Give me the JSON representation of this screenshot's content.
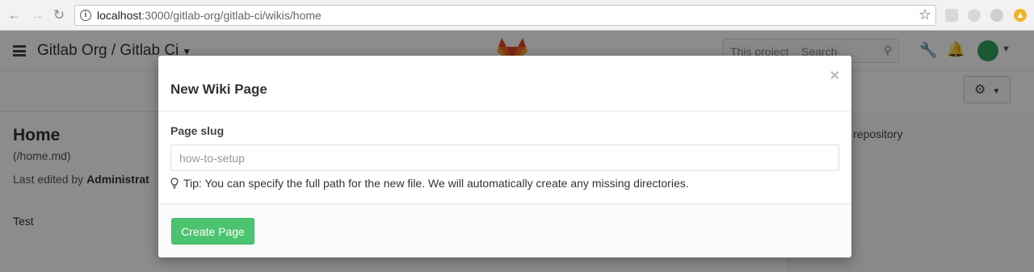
{
  "browser": {
    "url_host": "localhost",
    "url_rest": ":3000/gitlab-org/gitlab-ci/wikis/home"
  },
  "app": {
    "title": "Gitlab Org / Gitlab Ci",
    "search_scope": "This project",
    "search_placeholder": "Search",
    "page_title": "Home",
    "page_path": "(/home.md)",
    "last_edited_prefix": "Last edited by ",
    "last_edited_user": "Administrat",
    "page_body": "Test",
    "side_link": "repository"
  },
  "modal": {
    "title": "New Wiki Page",
    "close": "×",
    "label": "Page slug",
    "input_placeholder": "how-to-setup",
    "input_value": "",
    "tip": "Tip: You can specify the full path for the new file. We will automatically create any missing directories.",
    "submit": "Create Page"
  },
  "colors": {
    "primary_button": "#4cc46f",
    "overlay": "rgba(0,0,0,0.45)"
  }
}
